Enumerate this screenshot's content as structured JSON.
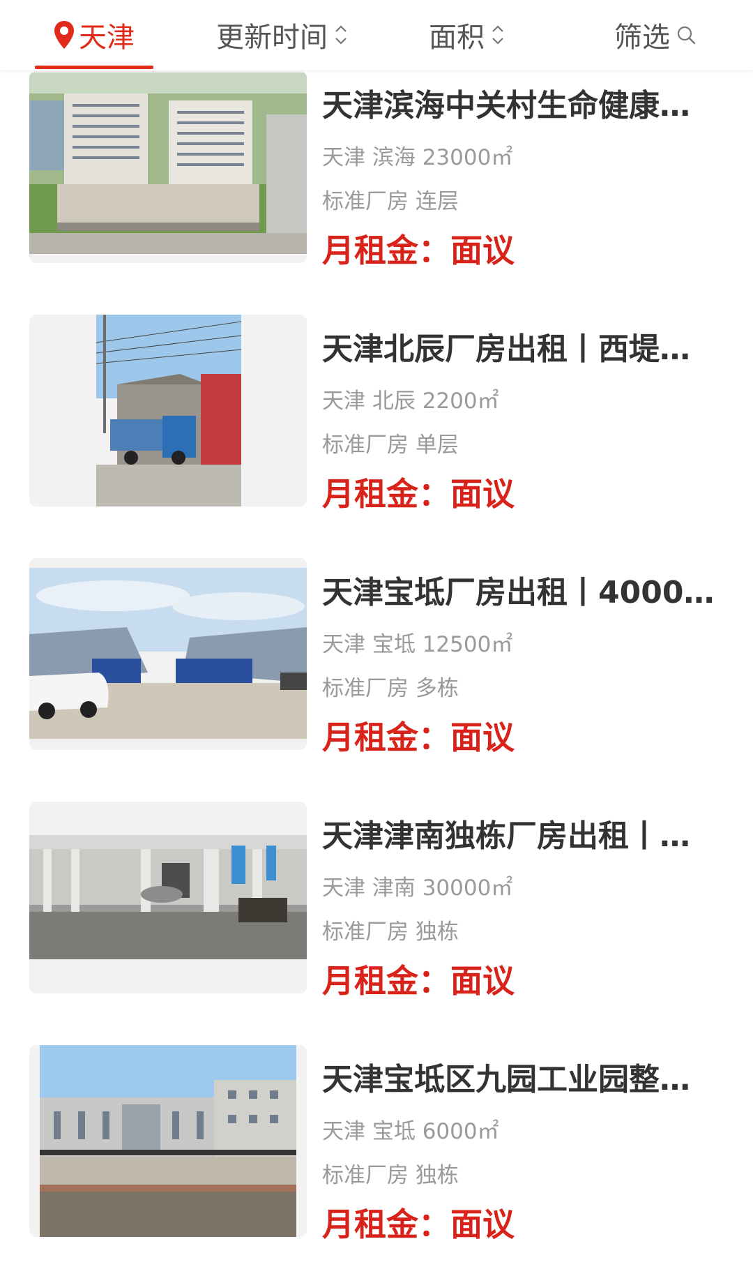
{
  "filter_bar": {
    "city": "天津",
    "sort_time": "更新时间",
    "sort_area": "面积",
    "filter": "筛选",
    "accent_color": "#e02a1a"
  },
  "listings": [
    {
      "title": "天津滨海中关村生命健康…",
      "location": "天津 滨海 23000㎡",
      "type": "标准厂房 连层",
      "price": "月租金：面议"
    },
    {
      "title": "天津北辰厂房出租丨西堤…",
      "location": "天津 北辰 2200㎡",
      "type": "标准厂房 单层",
      "price": "月租金：面议"
    },
    {
      "title": "天津宝坻厂房出租丨4000~…",
      "location": "天津 宝坻 12500㎡",
      "type": "标准厂房 多栋",
      "price": "月租金：面议"
    },
    {
      "title": "天津津南独栋厂房出租丨…",
      "location": "天津 津南 30000㎡",
      "type": "标准厂房 独栋",
      "price": "月租金：面议"
    },
    {
      "title": "天津宝坻区九园工业园整…",
      "location": "天津 宝坻 6000㎡",
      "type": "标准厂房 独栋",
      "price": "月租金：面议"
    }
  ]
}
